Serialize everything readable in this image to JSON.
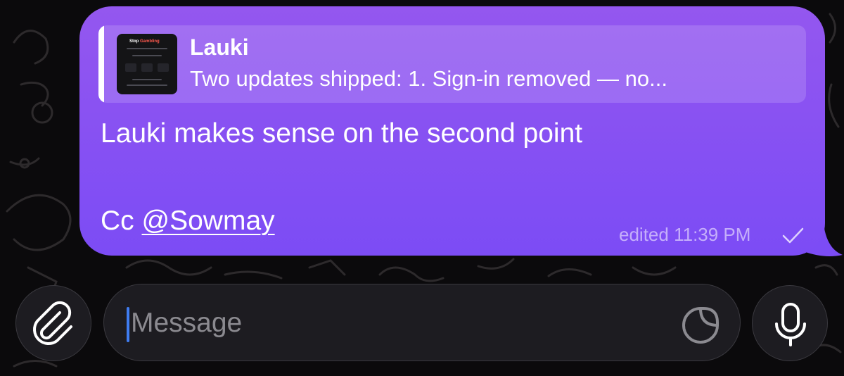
{
  "colors": {
    "bubble": "#8a52f2",
    "background": "#0b0a0c",
    "caret": "#3f7cf0",
    "input_bg": "#1d1c21"
  },
  "message": {
    "reply": {
      "author": "Lauki",
      "preview": "Two updates shipped: 1. Sign-in removed — no...",
      "thumbnail": {
        "title_prefix": "Stop",
        "title_highlight": "Gambling"
      }
    },
    "lines": {
      "line1": "Lauki makes sense on the second point",
      "cc_prefix": "Cc ",
      "mention": "@Sowmay"
    },
    "meta": {
      "status": "edited",
      "time": "11:39 PM",
      "read_icon": "check-icon"
    }
  },
  "composer": {
    "placeholder": "Message",
    "attach_icon": "paperclip-icon",
    "sticker_icon": "sticker-icon",
    "mic_icon": "microphone-icon"
  }
}
